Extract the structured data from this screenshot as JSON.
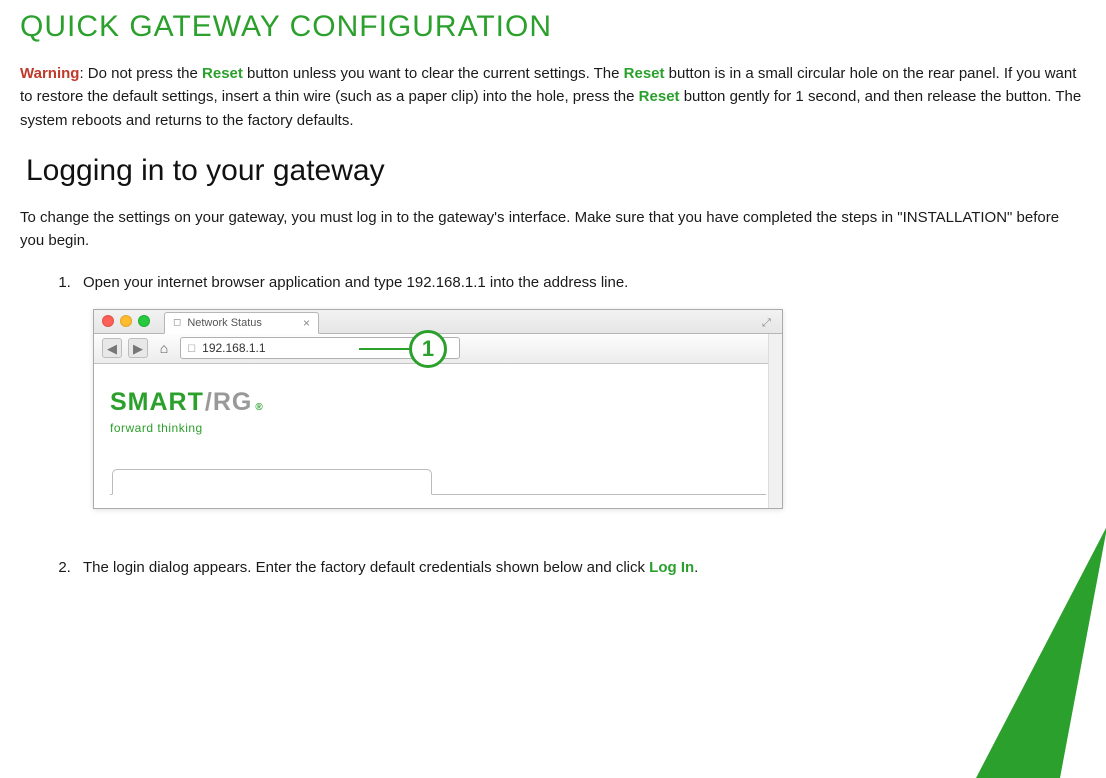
{
  "title": "QUICK GATEWAY CONFIGURATION",
  "warning": {
    "label": "Warning",
    "part1": ": Do not press the ",
    "reset1": "Reset",
    "part2": " button unless you want to clear the current settings. The ",
    "reset2": "Reset",
    "part3": " button is in a small circular hole on the rear panel. If you want to restore the default settings, insert a thin wire (such as a paper clip) into the hole, press the ",
    "reset3": "Reset",
    "part4": " button gently for 1 second, and then release the button. The system reboots and returns to the factory defaults."
  },
  "subheading": "Logging in to your gateway",
  "intro": "To change the settings on your gateway, you must log in to the gateway's interface. Make sure that you have completed the steps in \"INSTALLATION\" before you begin.",
  "steps": {
    "s1": "Open your internet browser application and type 192.168.1.1 into the address line.",
    "s2_a": "The login dialog appears. Enter the factory default credentials shown below and click ",
    "s2_login": "Log In",
    "s2_b": "."
  },
  "browser": {
    "tab_title": "Network Status",
    "address": "192.168.1.1",
    "callout": "1",
    "logo_smart": "SMART",
    "logo_rg": "RG",
    "logo_tagline": "forward thinking"
  }
}
